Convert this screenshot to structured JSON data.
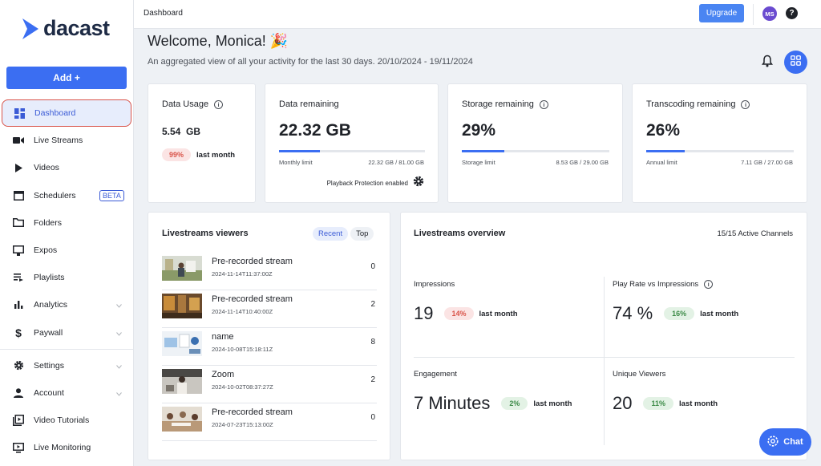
{
  "brand": {
    "name": "dacast",
    "logo_color": "#3b6ef2"
  },
  "sidebar": {
    "add_label": "Add +",
    "items": [
      {
        "label": "Dashboard",
        "icon": "dashboard-icon"
      },
      {
        "label": "Live Streams",
        "icon": "camera-icon"
      },
      {
        "label": "Videos",
        "icon": "play-icon"
      },
      {
        "label": "Schedulers",
        "icon": "calendar-icon",
        "badge": "BETA"
      },
      {
        "label": "Folders",
        "icon": "folder-icon"
      },
      {
        "label": "Expos",
        "icon": "monitor-icon"
      },
      {
        "label": "Playlists",
        "icon": "playlist-icon"
      },
      {
        "label": "Analytics",
        "icon": "bar-chart-icon"
      },
      {
        "label": "Paywall",
        "icon": "dollar-icon"
      },
      {
        "label": "Settings",
        "icon": "gear-icon"
      },
      {
        "label": "Account",
        "icon": "user-icon"
      },
      {
        "label": "Video Tutorials",
        "icon": "video-library-icon"
      },
      {
        "label": "Live Monitoring",
        "icon": "live-monitor-icon"
      }
    ]
  },
  "topbar": {
    "breadcrumb": "Dashboard",
    "upgrade_label": "Upgrade",
    "avatar_initials": "MS",
    "help": "?"
  },
  "welcome": {
    "title": "Welcome, Monica! 🎉",
    "subtitle": "An aggregated view of all your activity for the last 30 days. 20/10/2024 - 19/11/2024"
  },
  "data_usage": {
    "title": "Data Usage",
    "value": "5.54  GB",
    "pct": "99%",
    "suffix": "last month"
  },
  "data_remaining": {
    "title": "Data remaining",
    "value": "22.32 GB",
    "fill": 0.28,
    "bar_label": "Monthly limit",
    "bar_value": "22.32 GB / 81.00 GB",
    "protection": "Playback Protection enabled"
  },
  "storage": {
    "title": "Storage remaining",
    "value": "29%",
    "fill": 0.29,
    "bar_label": "Storage limit",
    "bar_value": "8.53 GB / 29.00 GB"
  },
  "transcoding": {
    "title": "Transcoding remaining",
    "value": "26%",
    "fill": 0.26,
    "bar_label": "Annual limit",
    "bar_value": "7.11 GB / 27.00 GB"
  },
  "viewers": {
    "title": "Livestreams viewers",
    "tab_recent": "Recent",
    "tab_top": "Top",
    "rows": [
      {
        "name": "Pre-recorded stream",
        "date": "2024-11-14T11:37:00Z",
        "count": "0"
      },
      {
        "name": "Pre-recorded stream",
        "date": "2024-11-14T10:40:00Z",
        "count": "2"
      },
      {
        "name": "name",
        "date": "2024-10-08T15:18:11Z",
        "count": "8"
      },
      {
        "name": "Zoom",
        "date": "2024-10-02T08:37:27Z",
        "count": "2"
      },
      {
        "name": "Pre-recorded stream",
        "date": "2024-07-23T15:13:00Z",
        "count": "0"
      }
    ]
  },
  "overview": {
    "title": "Livestreams overview",
    "channels": "15/15 Active Channels",
    "impressions": {
      "label": "Impressions",
      "value": "19",
      "pct": "14%",
      "suffix": "last month"
    },
    "play_rate": {
      "label": "Play Rate vs Impressions",
      "value": "74 %",
      "pct": "16%",
      "suffix": "last month"
    },
    "engagement": {
      "label": "Engagement",
      "value": "7 Minutes",
      "pct": "2%",
      "suffix": "last month"
    },
    "unique": {
      "label": "Unique Viewers",
      "value": "20",
      "pct": "11%",
      "suffix": "last month"
    }
  },
  "chat_label": "Chat"
}
